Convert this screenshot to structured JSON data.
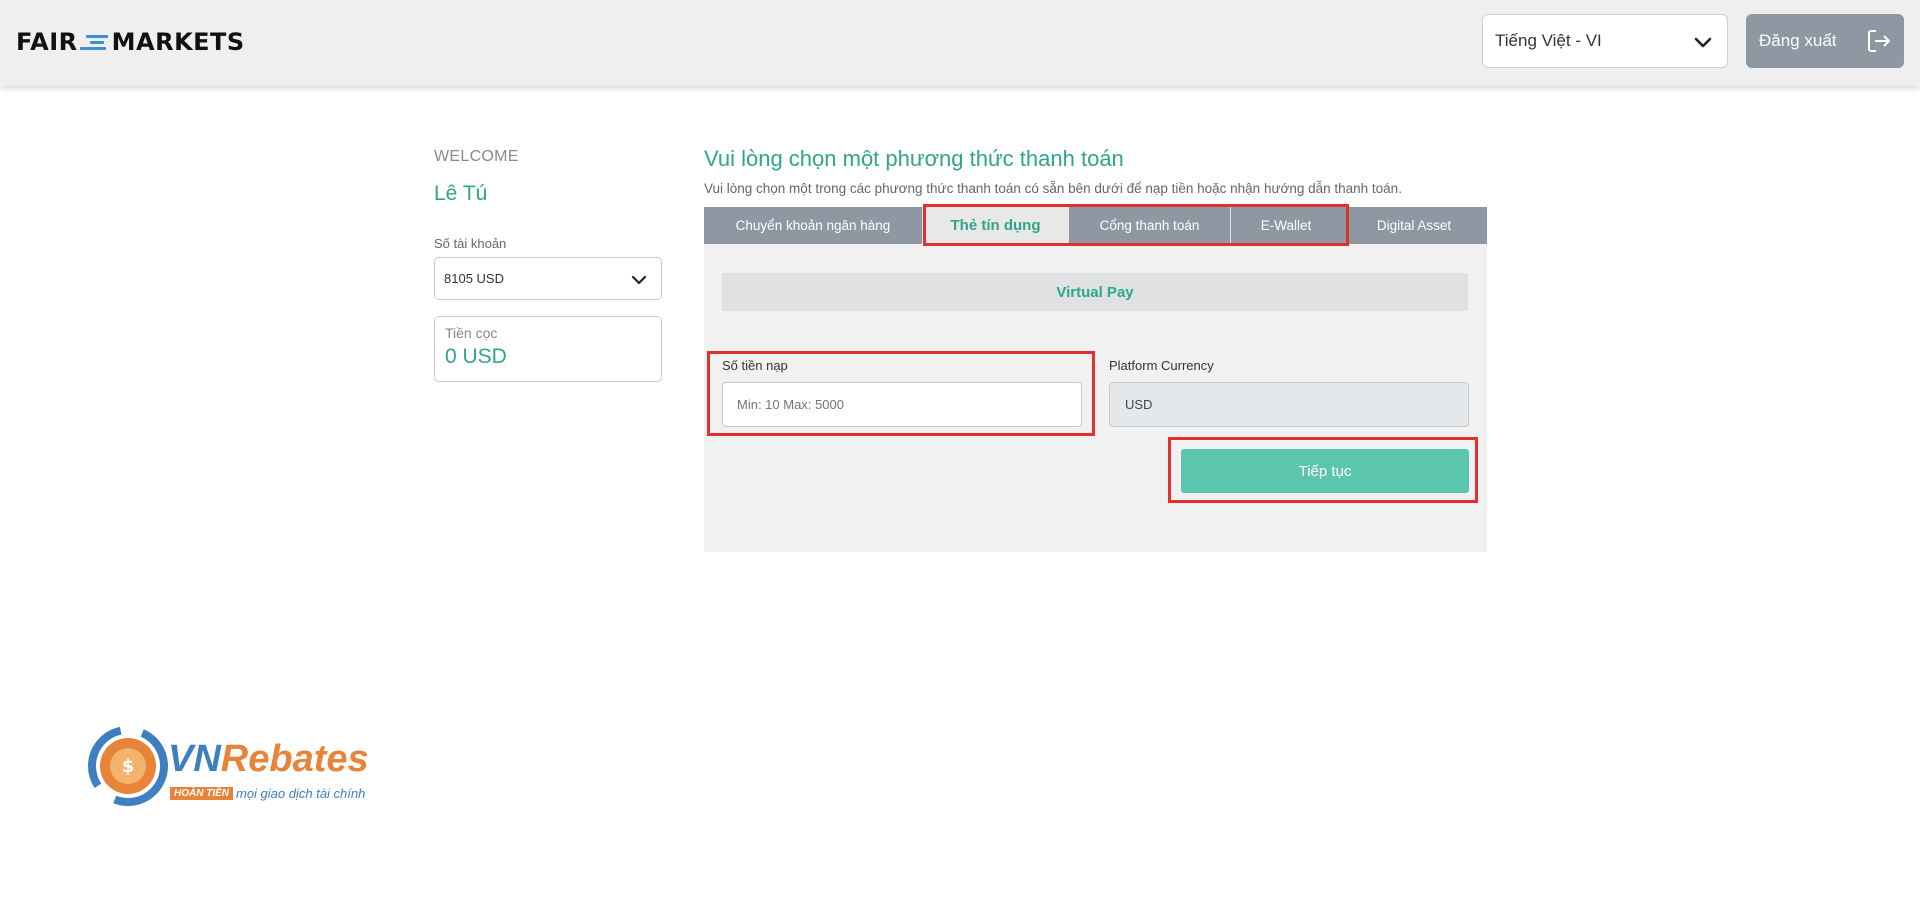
{
  "header": {
    "logo": {
      "left": "FAIR",
      "right": "MARKETS"
    },
    "language": "Tiếng Việt - VI",
    "logout_label": "Đăng xuất"
  },
  "sidebar": {
    "welcome": "WELCOME",
    "username": "Lê Tú",
    "account_label": "Số tài khoản",
    "account_value": "8105 USD",
    "deposit_label": "Tiền cọc",
    "deposit_value": "0 USD"
  },
  "main": {
    "title": "Vui lòng chọn một phương thức thanh toán",
    "subtitle": "Vui lòng chọn một trong các phương thức thanh toán có sẵn bên dưới để nạp tiền hoặc nhận hướng dẫn thanh toán.",
    "tabs": [
      {
        "label": "Chuyển khoản ngân hàng",
        "active": false
      },
      {
        "label": "Thẻ tín dụng",
        "active": true
      },
      {
        "label": "Cổng thanh toán",
        "active": false
      },
      {
        "label": "E-Wallet",
        "active": false
      },
      {
        "label": "Digital Asset",
        "active": false
      }
    ],
    "provider": "Virtual Pay",
    "amount_label": "Số tiền nạp",
    "amount_placeholder": "Min: 10 Max: 5000",
    "currency_label": "Platform Currency",
    "currency_value": "USD",
    "continue_label": "Tiếp tục"
  },
  "watermark": {
    "brand": "VNRebates",
    "tag": "HOÀN TIỀN",
    "tagline": "mọi giao dịch tài chính"
  },
  "colors": {
    "accent": "#2fa58a",
    "button": "#5cc5ae",
    "tab_bar": "#8d98a3",
    "highlight": "#e0312f",
    "watermark_orange": "#e8843a"
  }
}
